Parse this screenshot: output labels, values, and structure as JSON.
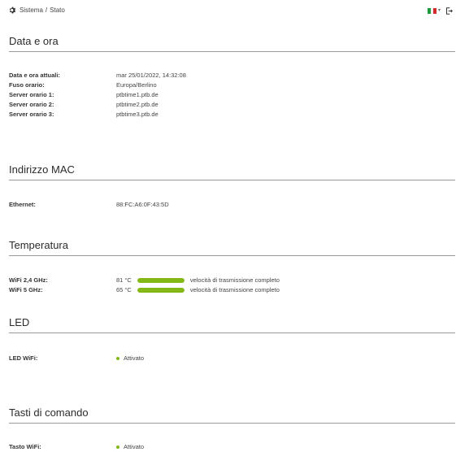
{
  "colors": {
    "accent_green": "#84b816",
    "flag_green": "#1d9a3a",
    "flag_white": "#f2f2f2",
    "flag_red": "#d62a2a"
  },
  "breadcrumb": {
    "icon": "gear-icon",
    "parent": "Sistema",
    "separator": "/",
    "current": "Stato"
  },
  "header": {
    "language_flag": "italy-flag-icon",
    "language_chevron": "▾",
    "logout_icon": "logout-icon"
  },
  "date_time": {
    "title": "Data e ora",
    "rows": [
      {
        "label": "Data e ora attuali:",
        "value": "mar 25/01/2022, 14:32:08"
      },
      {
        "label": "Fuso orario:",
        "value": "Europa/Berlino"
      },
      {
        "label": "Server orario 1:",
        "value": "ptbtime1.ptb.de"
      },
      {
        "label": "Server orario 2:",
        "value": "ptbtime2.ptb.de"
      },
      {
        "label": "Server orario 3:",
        "value": "ptbtime3.ptb.de"
      }
    ]
  },
  "mac": {
    "title": "Indirizzo MAC",
    "rows": [
      {
        "label": "Ethernet:",
        "value": "88:FC:A6:0F:43:5D"
      }
    ]
  },
  "temperature": {
    "title": "Temperatura",
    "rows": [
      {
        "label": "WiFi 2,4 GHz:",
        "value": "81 °C",
        "level": 1.0,
        "status": "velocità di trasmissione completo"
      },
      {
        "label": "WiFi 5 GHz:",
        "value": "65 °C",
        "level": 1.0,
        "status": "velocità di trasmissione completo"
      }
    ]
  },
  "led": {
    "title": "LED",
    "rows": [
      {
        "label": "LED WiFi:",
        "value": "Attivato"
      }
    ]
  },
  "buttons": {
    "title": "Tasti di comando",
    "rows": [
      {
        "label": "Tasto WiFi:",
        "value": "Attivato"
      }
    ]
  }
}
